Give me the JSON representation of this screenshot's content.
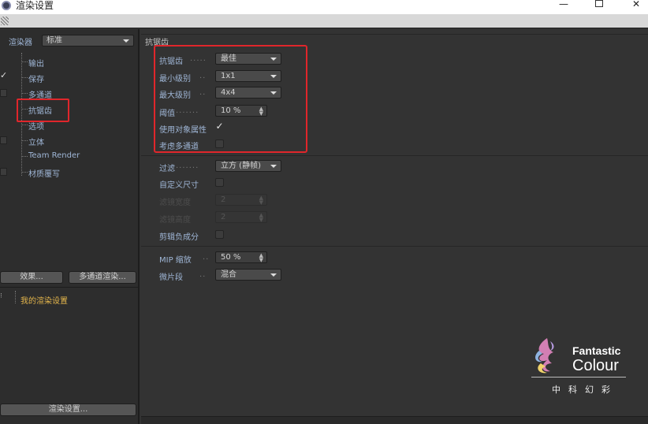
{
  "window": {
    "title": "渲染设置",
    "min": "—",
    "close": "✕"
  },
  "left": {
    "renderer_label": "渲染器",
    "renderer_value": "标准",
    "tree": [
      {
        "label": "输出",
        "check": "none"
      },
      {
        "label": "保存",
        "check": "checked"
      },
      {
        "label": "多通道",
        "check": "box"
      },
      {
        "label": "抗锯齿",
        "check": "none"
      },
      {
        "label": "选项",
        "check": "none"
      },
      {
        "label": "立体",
        "check": "box"
      },
      {
        "label": "Team Render",
        "check": "none"
      },
      {
        "label": "材质覆写",
        "check": "box"
      }
    ],
    "effect_button": "效果...",
    "multipass_button": "多通道渲染...",
    "settings_item": "我的渲染设置",
    "render_settings_button": "渲染设置..."
  },
  "right": {
    "section_title": "抗锯齿",
    "rows": {
      "antialias": {
        "label": "抗锯齿",
        "value": "最佳"
      },
      "min_level": {
        "label": "最小级别",
        "value": "1x1"
      },
      "max_level": {
        "label": "最大级别",
        "value": "4x4"
      },
      "threshold": {
        "label": "阈值",
        "value": "10 %"
      },
      "use_object_props": {
        "label": "使用对象属性",
        "checked": true,
        "mark": "✓"
      },
      "consider_multipass": {
        "label": "考虑多通道",
        "checked": false
      },
      "filter": {
        "label": "过滤",
        "value": "立方 (静帧)"
      },
      "custom_size": {
        "label": "自定义尺寸",
        "checked": false
      },
      "filter_width": {
        "label": "滤镜宽度",
        "value": "2"
      },
      "filter_height": {
        "label": "滤镜高度",
        "value": "2"
      },
      "clip_negative": {
        "label": "剪辑负成分",
        "checked": false
      },
      "mip_scale": {
        "label": "MIP 缩放",
        "value": "50 %"
      },
      "micropoly": {
        "label": "微片段",
        "value": "混合"
      }
    }
  },
  "logo": {
    "line1": "Fantastic",
    "line2": "Colour",
    "cn": "中科幻彩"
  },
  "colors": {
    "accent_label": "#9fb6d6",
    "highlight": "#e0262b",
    "settings_item": "#e3b54c"
  }
}
